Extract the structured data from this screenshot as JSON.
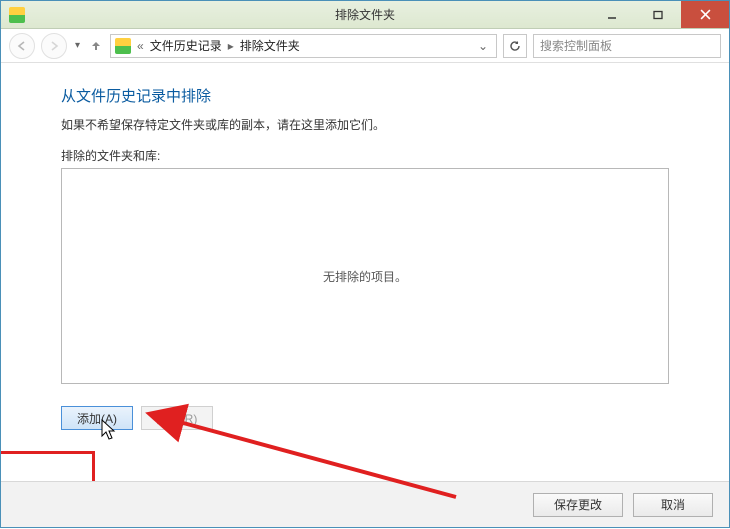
{
  "titlebar": {
    "title": "排除文件夹"
  },
  "nav": {
    "crumb_prefix": "«",
    "crumb1": "文件历史记录",
    "crumb2": "排除文件夹",
    "search_placeholder": "搜索控制面板"
  },
  "page": {
    "heading": "从文件历史记录中排除",
    "desc": "如果不希望保存特定文件夹或库的副本，请在这里添加它们。",
    "list_label": "排除的文件夹和库:",
    "empty_text": "无排除的项目。",
    "add_button": "添加(A)",
    "remove_button": "删除(R)"
  },
  "footer": {
    "save": "保存更改",
    "cancel": "取消"
  }
}
